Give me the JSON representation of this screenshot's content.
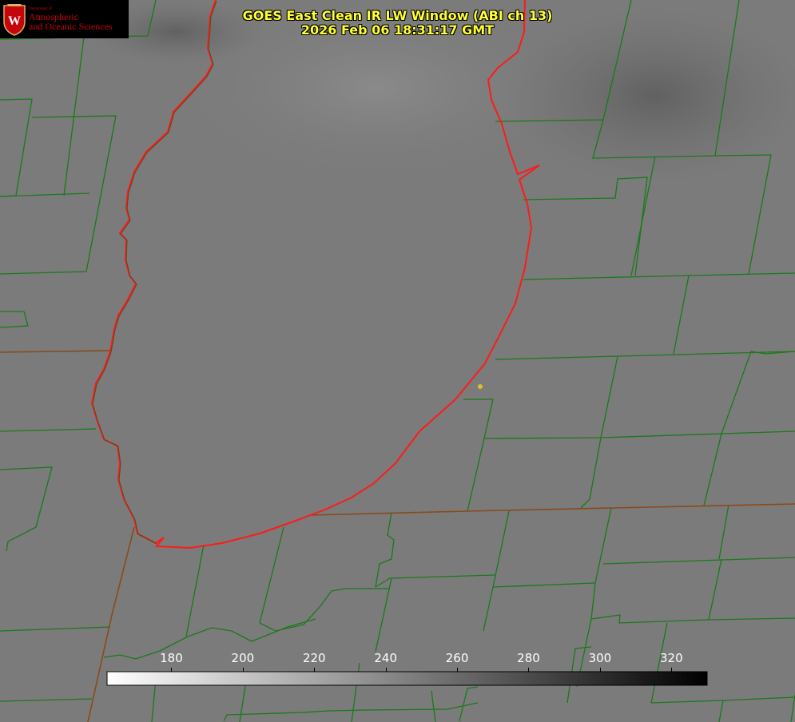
{
  "title": {
    "line1": "GOES East Clean IR LW Window (ABI ch 13)",
    "line2": "2026 Feb 06 18:31:17 GMT"
  },
  "logo": {
    "department": "Department of",
    "line1": "Atmospheric",
    "line2": "and Oceanic Sciences",
    "seal_letter": "W"
  },
  "colorbar": {
    "tick_labels": [
      "180",
      "200",
      "220",
      "240",
      "260",
      "280",
      "300",
      "320"
    ],
    "ticks": [
      180,
      200,
      220,
      240,
      260,
      280,
      300,
      320
    ],
    "range_min": 162,
    "range_max": 330,
    "gradient": [
      "#ffffff",
      "#000000"
    ]
  },
  "colors": {
    "background_gray": "#7b7b7b",
    "county_lines": "#1a7a1a",
    "coastline": "#ff1a1a",
    "title_text": "#ffff33",
    "marker": "#d9c22a",
    "logo_red": "#c5050c"
  }
}
